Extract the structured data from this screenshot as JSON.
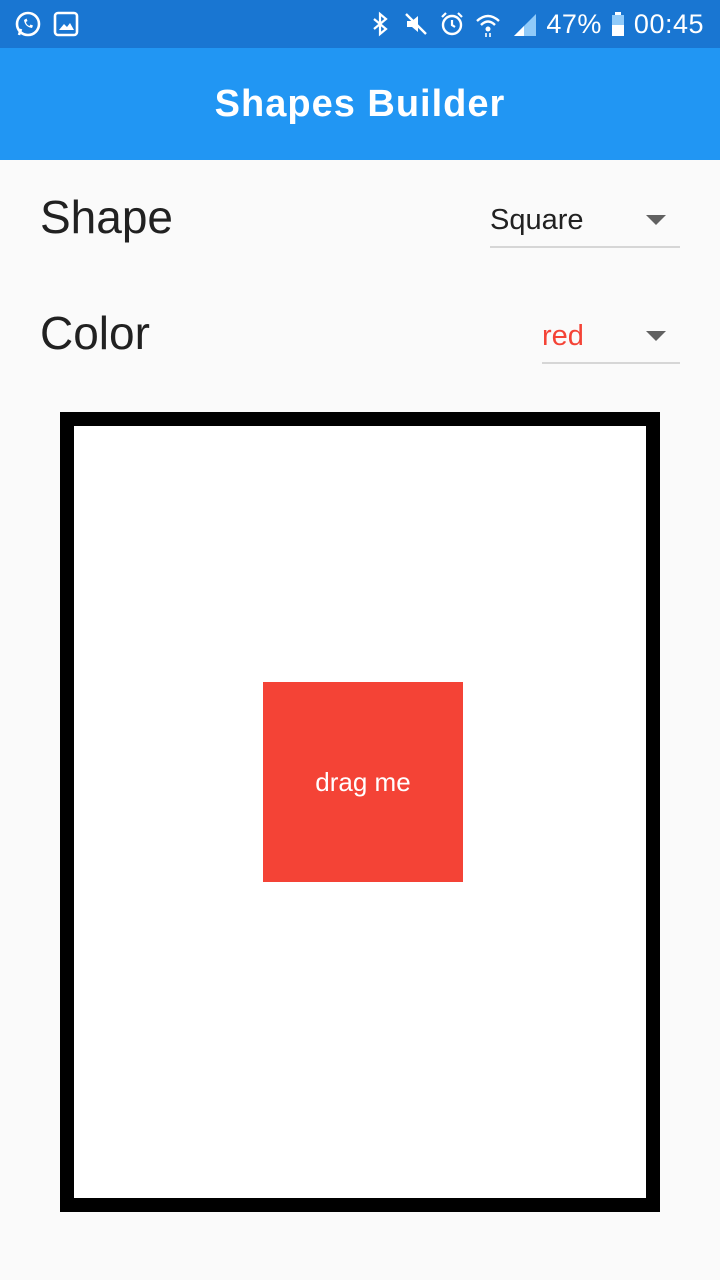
{
  "status_bar": {
    "battery": "47%",
    "time": "00:45",
    "icons_left": [
      "whatsapp-icon",
      "gallery-icon"
    ],
    "icons_right": [
      "bluetooth-icon",
      "mute-icon",
      "alarm-icon",
      "wifi-icon",
      "signal-icon",
      "battery-icon"
    ]
  },
  "app_bar": {
    "title": "Shapes Builder",
    "color": "#2196f3",
    "status_color": "#1976d2"
  },
  "form": {
    "shape_label": "Shape",
    "shape_value": "Square",
    "color_label": "Color",
    "color_value": "red",
    "color_value_color": "#f44336"
  },
  "canvas": {
    "shape_type": "square",
    "shape_color": "#f44336",
    "shape_text": "drag me"
  }
}
